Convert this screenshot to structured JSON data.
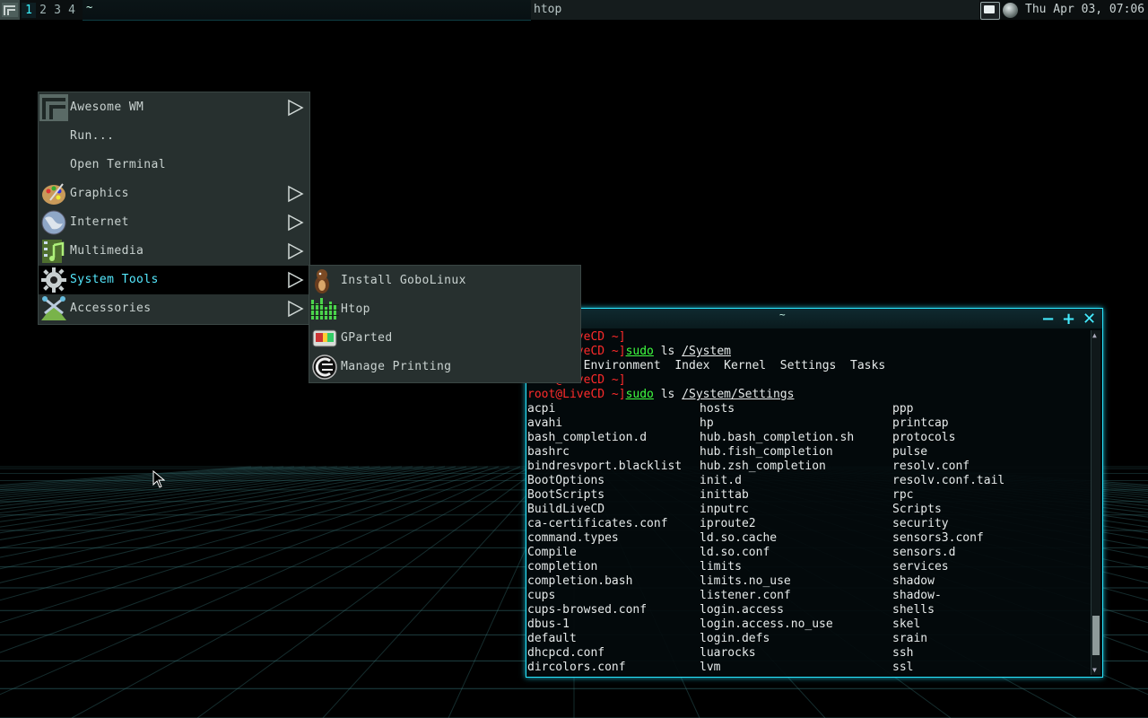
{
  "topbar": {
    "tags": [
      "1",
      "2",
      "3",
      "4"
    ],
    "active_tag": "1",
    "active_task_title": "~",
    "task_title": "htop",
    "clock": "Thu Apr 03, 07:06"
  },
  "main_menu": {
    "items": [
      {
        "label": "Awesome WM",
        "icon": "awesome-icon",
        "submenu": true
      },
      {
        "label": "Run...",
        "icon": "",
        "submenu": false
      },
      {
        "label": "Open Terminal",
        "icon": "",
        "submenu": false
      },
      {
        "label": "Graphics",
        "icon": "palette-icon",
        "submenu": true
      },
      {
        "label": "Internet",
        "icon": "globe-icon",
        "submenu": true
      },
      {
        "label": "Multimedia",
        "icon": "multimedia-icon",
        "submenu": true
      },
      {
        "label": "System Tools",
        "icon": "gear-icon",
        "submenu": true,
        "selected": true
      },
      {
        "label": "Accessories",
        "icon": "accessories-icon",
        "submenu": true
      }
    ]
  },
  "sub_menu": {
    "items": [
      {
        "label": "Install GoboLinux",
        "icon": "gobolinux-icon"
      },
      {
        "label": "Htop",
        "icon": "htop-icon"
      },
      {
        "label": "GParted",
        "icon": "gparted-icon"
      },
      {
        "label": "Manage Printing",
        "icon": "printing-icon"
      }
    ]
  },
  "terminal": {
    "title": "~",
    "prompt": "root@LiveCD ~]",
    "line1_prompt": "root@LiveCD ~]",
    "line2_cmd": "sudo",
    "line2_rest": " ls ",
    "line2_arg": "/System",
    "line3": "Aliens  Environment  Index  Kernel  Settings  Tasks",
    "line4_prompt": "root@LiveCD ~]",
    "line5_cmd": "sudo",
    "line5_rest": " ls ",
    "line5_arg": "/System/Settings",
    "listing_col1": [
      "acpi",
      "avahi",
      "bash_completion.d",
      "bashrc",
      "bindresvport.blacklist",
      "BootOptions",
      "BootScripts",
      "BuildLiveCD",
      "ca-certificates.conf",
      "command.types",
      "Compile",
      "completion",
      "completion.bash",
      "cups",
      "cups-browsed.conf",
      "dbus-1",
      "default",
      "dhcpcd.conf",
      "dircolors.conf"
    ],
    "listing_col2": [
      "hosts",
      "hp",
      "hub.bash_completion.sh",
      "hub.fish_completion",
      "hub.zsh_completion",
      "init.d",
      "inittab",
      "inputrc",
      "iproute2",
      "ld.so.cache",
      "ld.so.conf",
      "limits",
      "limits.no_use",
      "listener.conf",
      "login.access",
      "login.access.no_use",
      "login.defs",
      "luarocks",
      "lvm"
    ],
    "listing_col3": [
      "ppp",
      "printcap",
      "protocols",
      "pulse",
      "resolv.conf",
      "resolv.conf.tail",
      "rpc",
      "Scripts",
      "security",
      "sensors3.conf",
      "sensors.d",
      "services",
      "shadow",
      "shadow-",
      "shells",
      "skel",
      "srain",
      "ssh",
      "ssl"
    ]
  },
  "colors": {
    "accent": "#29e6ff",
    "prompt": "#ff2b2b",
    "command": "#40ff40",
    "menu_bg": "#27302f",
    "selected_text": "#55e9ff"
  }
}
